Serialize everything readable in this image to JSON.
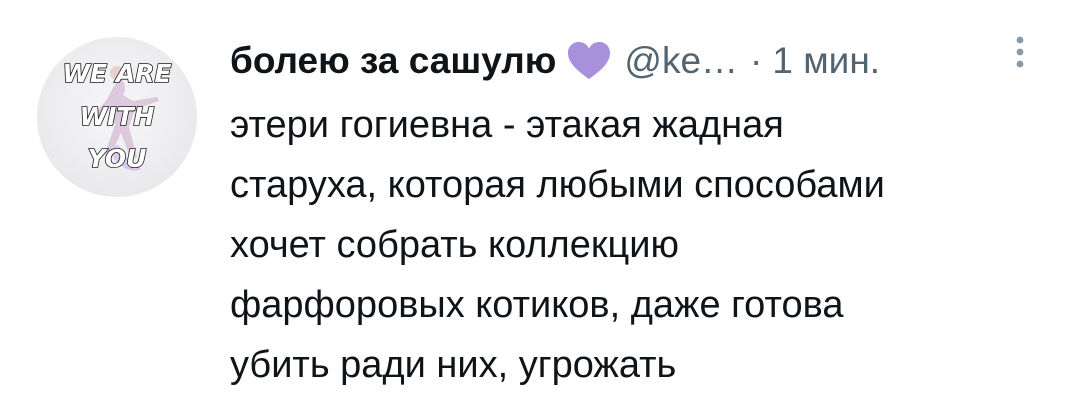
{
  "author": {
    "display_name": "болею за сашулю",
    "handle": "@ke…",
    "separator": "·",
    "time": "1 мин.",
    "badge_icon": "purple-heart-icon",
    "badge_color": "#a890dc"
  },
  "avatar": {
    "text_lines": [
      "WE ARE",
      "WITH",
      "YOU"
    ]
  },
  "tweet": {
    "lines": [
      "этери гогиевна - этакая жадная",
      "старуха, которая любыми способами",
      "хочет собрать коллекцию",
      "фарфоровых котиков, даже готова",
      "убить ради них, угрожать"
    ]
  },
  "menu": {
    "icon": "vertical-dots-icon"
  },
  "colors": {
    "text": "#0f1419",
    "secondary": "#536471"
  }
}
